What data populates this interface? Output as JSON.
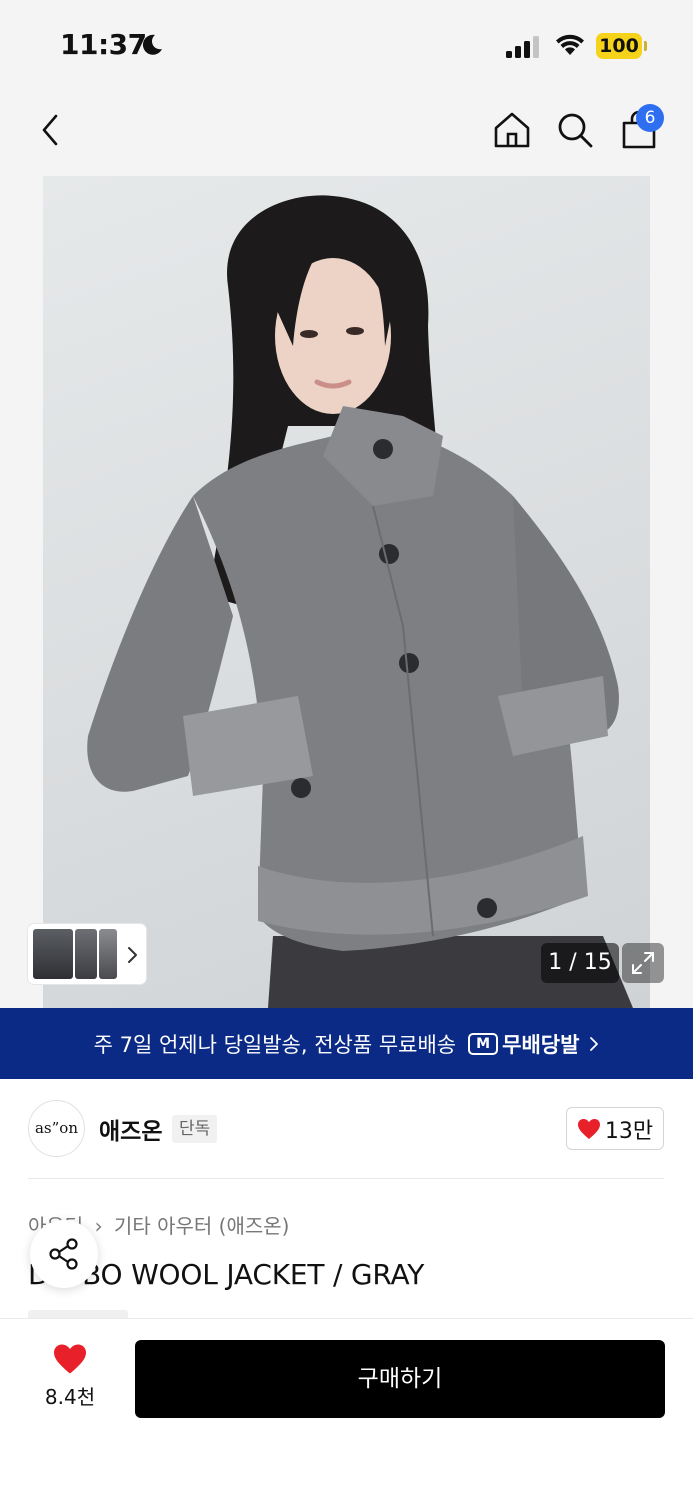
{
  "status_bar": {
    "time": "11:37",
    "battery": "100"
  },
  "nav": {
    "cart_count": "6"
  },
  "gallery": {
    "counter": "1 / 15"
  },
  "promo": {
    "text": "주 7일 언제나 당일발송, 전상품 무료배송",
    "logo_mark": "M",
    "logo_text": "무배당발"
  },
  "brand": {
    "logo_text": "as”on",
    "name": "애즈온",
    "tag": "단독",
    "like_count": "13만"
  },
  "product": {
    "breadcrumb": [
      "아우터",
      "기타 아우터 (애즈온)"
    ],
    "title": "D  MBO WOOL JACKET / GRAY"
  },
  "bottom": {
    "wish_count": "8.4천",
    "buy_label": "구매하기"
  },
  "colors": {
    "accent_blue": "#2e6ff2",
    "banner_navy": "#0a2a86",
    "heart_red": "#e8202a",
    "battery_yellow": "#f5d31a"
  }
}
